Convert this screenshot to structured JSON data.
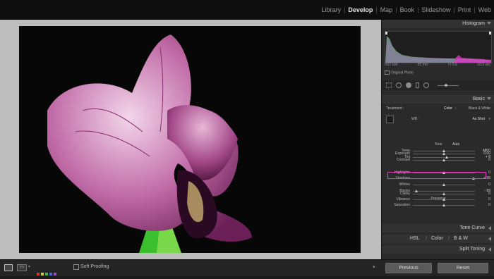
{
  "modules": [
    "Library",
    "Develop",
    "Map",
    "Book",
    "Slideshow",
    "Print",
    "Web"
  ],
  "active_module": "Develop",
  "panel": {
    "histogram": {
      "title": "Histogram",
      "iso": "ISO 100",
      "focal": "85 mm",
      "aperture": "f / 5.6",
      "shutter": "1/13 sec",
      "original_photo": "Original Photo"
    },
    "basic": {
      "title": "Basic",
      "treatment_label": "Treatment :",
      "treatment_color": "Color",
      "treatment_bw": "Black & White",
      "wb_label": "WB :",
      "wb_value": "As Shot",
      "tone_label": "Tone",
      "auto_label": "Auto",
      "presence_label": "Presence",
      "sliders": [
        {
          "label": "Temp",
          "value": "4800"
        },
        {
          "label": "Tint",
          "value": "+ 8"
        },
        {
          "label": "Exposure",
          "value": "0.00"
        },
        {
          "label": "Contrast",
          "value": "0"
        },
        {
          "label": "Highlights",
          "value": "0"
        },
        {
          "label": "Shadows",
          "value": "+ 96"
        },
        {
          "label": "Whites",
          "value": "0"
        },
        {
          "label": "Blacks",
          "value": "- 89"
        },
        {
          "label": "Clarity",
          "value": "0"
        },
        {
          "label": "Vibrance",
          "value": "0"
        },
        {
          "label": "Saturation",
          "value": "0"
        }
      ]
    },
    "tone_curve": "Tone Curve",
    "hsl": {
      "hsl": "HSL",
      "color": "Color",
      "bw": "B & W"
    },
    "split_toning": "Split Toning"
  },
  "toolbar": {
    "soft_proofing": "Soft Proofing",
    "previous": "Previous",
    "reset": "Reset"
  },
  "colors": {
    "highlight_box": "#e03fb9",
    "swatches": [
      "#d23a3a",
      "#d6c63a",
      "#4bb34b",
      "#3a6fd6",
      "#9a4bd6"
    ]
  }
}
